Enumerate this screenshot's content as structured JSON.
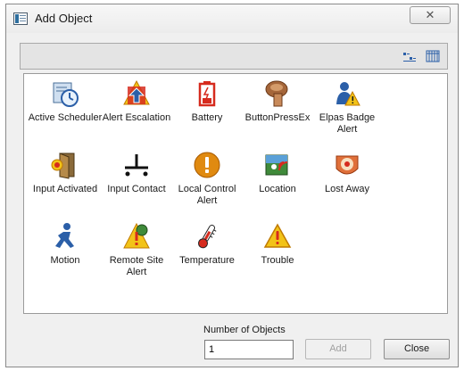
{
  "window": {
    "title": "Add Object",
    "close_glyph": "✕"
  },
  "toolbar": {
    "list_view_icon": "list-view-icon",
    "grid_view_icon": "grid-view-icon"
  },
  "objects": [
    {
      "label": "Active Scheduler",
      "icon": "scheduler-clock-icon"
    },
    {
      "label": "Alert Escalation",
      "icon": "alert-escalation-icon"
    },
    {
      "label": "Battery",
      "icon": "battery-icon"
    },
    {
      "label": "ButtonPressEx",
      "icon": "button-press-hand-icon"
    },
    {
      "label": "Elpas Badge Alert",
      "icon": "badge-person-alert-icon"
    },
    {
      "label": "Input Activated",
      "icon": "input-activated-door-icon"
    },
    {
      "label": "Input Contact",
      "icon": "input-contact-icon"
    },
    {
      "label": "Local Control Alert",
      "icon": "local-control-alert-icon"
    },
    {
      "label": "Location",
      "icon": "location-signal-icon"
    },
    {
      "label": "Lost Away",
      "icon": "lost-away-icon"
    },
    {
      "label": "Motion",
      "icon": "motion-runner-icon"
    },
    {
      "label": "Remote Site Alert",
      "icon": "remote-site-alert-icon"
    },
    {
      "label": "Temperature",
      "icon": "thermometer-icon"
    },
    {
      "label": "Trouble",
      "icon": "trouble-warning-icon"
    }
  ],
  "footer": {
    "count_label": "Number of Objects",
    "count_value": "1",
    "add_label": "Add",
    "close_label": "Close"
  },
  "colors": {
    "warning_yellow": "#f2c318",
    "alert_red": "#d62b1e",
    "orange": "#e08a10",
    "blue": "#2b5fa8"
  }
}
